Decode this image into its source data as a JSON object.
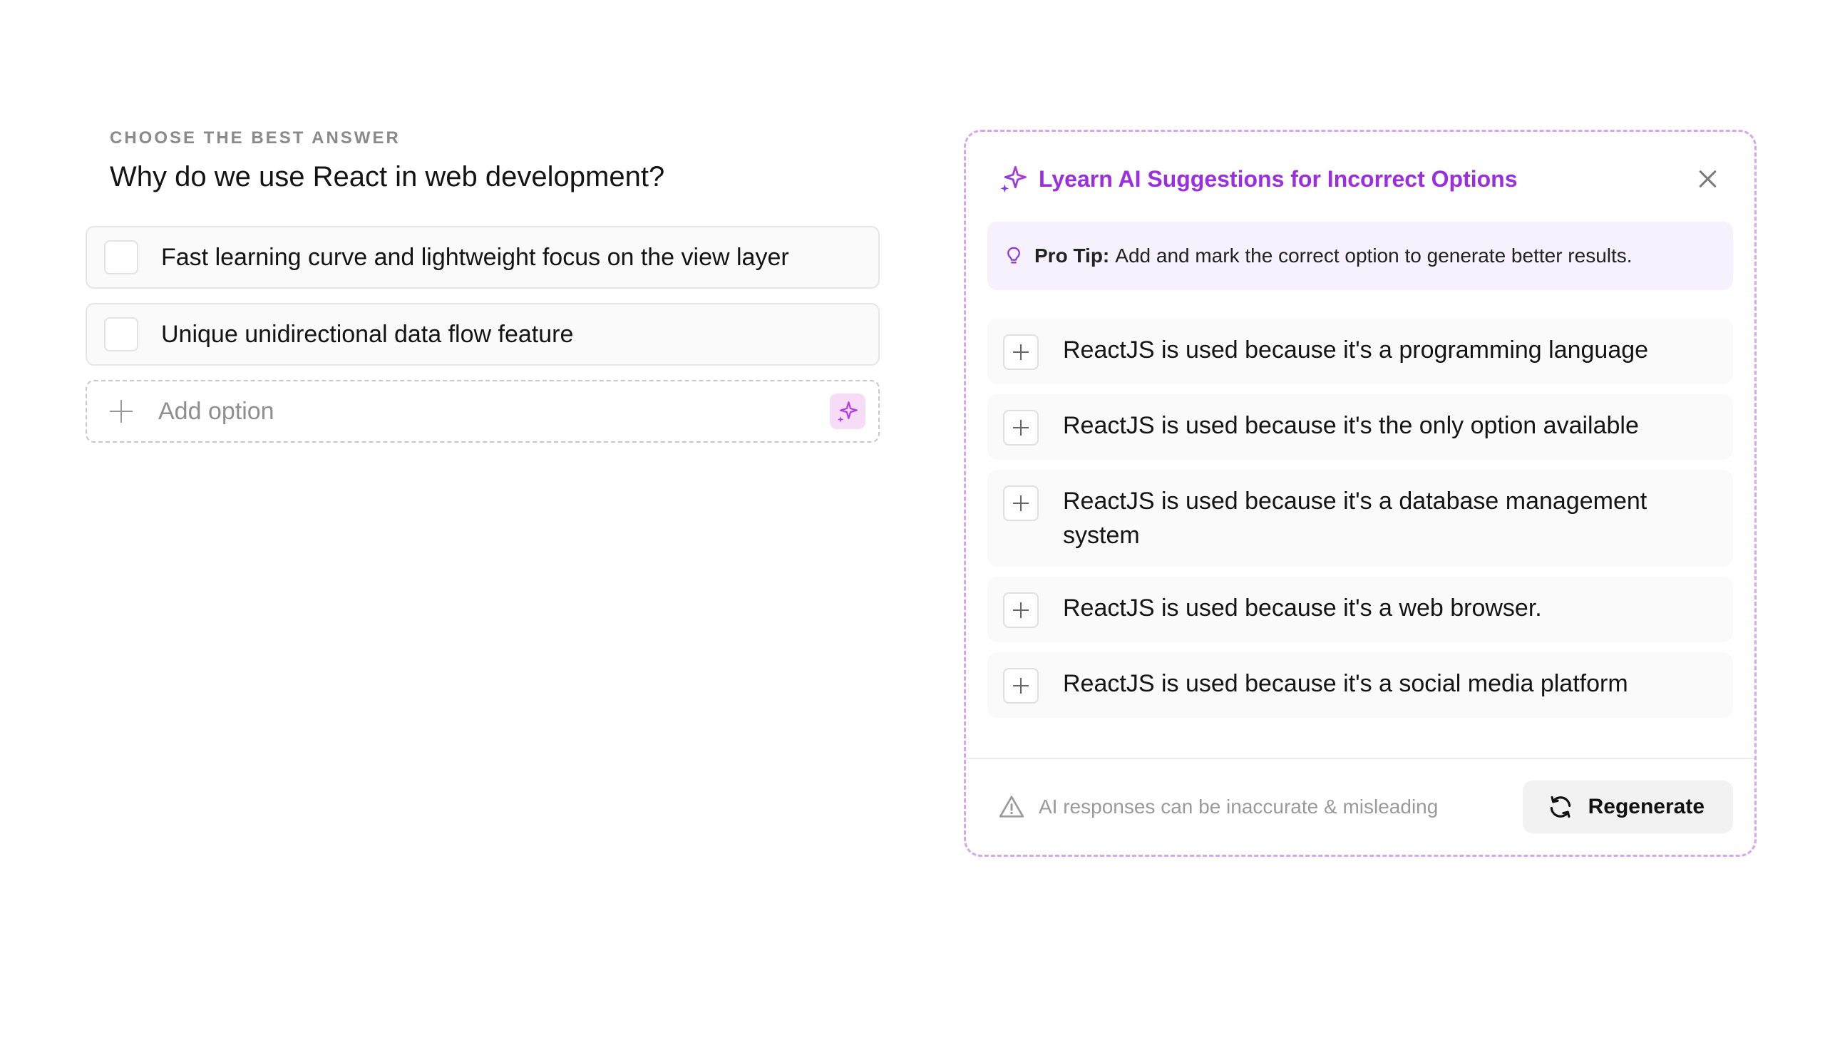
{
  "question": {
    "label": "CHOOSE THE BEST ANSWER",
    "title": "Why do we use React in web development?",
    "options": [
      {
        "text": "Fast learning curve and lightweight focus on the view layer"
      },
      {
        "text": "Unique unidirectional data flow feature"
      }
    ],
    "add_option_placeholder": "Add option"
  },
  "panel": {
    "title": "Lyearn AI Suggestions for Incorrect Options",
    "tip_strong": "Pro Tip:",
    "tip_text": "Add and mark the correct option to generate better results.",
    "suggestions": [
      {
        "text": "ReactJS is used because it's a programming language"
      },
      {
        "text": "ReactJS is used because it's the only option available"
      },
      {
        "text": "ReactJS is used because it's a database management system"
      },
      {
        "text": "ReactJS is used because it's a web browser."
      },
      {
        "text": "ReactJS is used because it's a social media platform"
      }
    ],
    "disclaimer": "AI responses can be inaccurate & misleading",
    "regenerate_label": "Regenerate"
  },
  "colors": {
    "accent": "#9b2ee0",
    "accent_soft": "#f7f0fd",
    "panel_border": "#d8a6ef"
  },
  "icons": {
    "ai": "sparkle-icon",
    "tip": "lightbulb-icon",
    "close": "close-icon",
    "warning": "warning-icon",
    "regenerate": "refresh-icon",
    "add": "plus-icon"
  }
}
